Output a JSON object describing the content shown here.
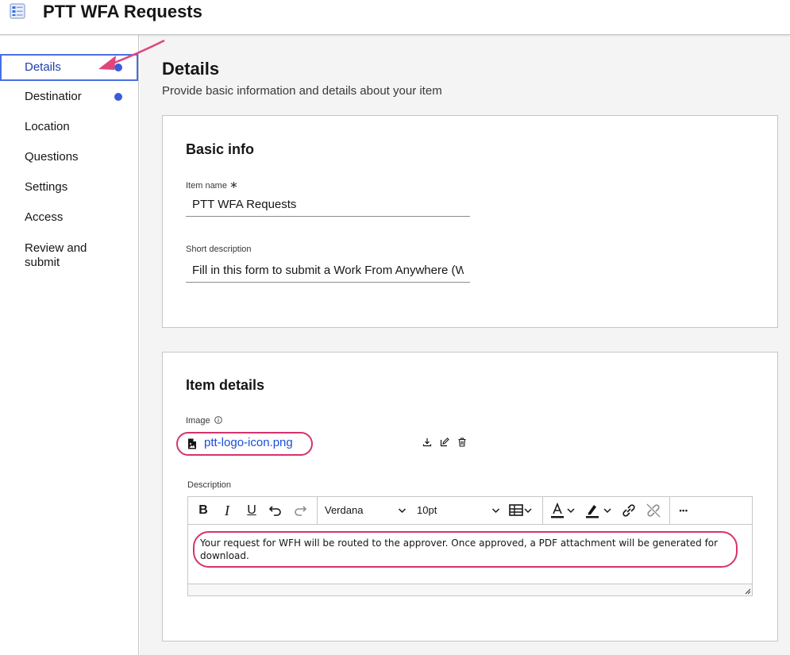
{
  "header": {
    "title": "PTT WFA Requests",
    "icon": "form-list-icon"
  },
  "sidebar": {
    "items": [
      {
        "label": "Details",
        "active": true,
        "dot": true
      },
      {
        "label": "Destinatior",
        "active": false,
        "dot": true
      },
      {
        "label": "Location",
        "active": false,
        "dot": false
      },
      {
        "label": "Questions",
        "active": false,
        "dot": false
      },
      {
        "label": "Settings",
        "active": false,
        "dot": false
      },
      {
        "label": "Access",
        "active": false,
        "dot": false
      },
      {
        "label": "Review and submit",
        "active": false,
        "dot": false
      }
    ],
    "dot_color": "#3b5bdb"
  },
  "main": {
    "title": "Details",
    "subtitle": "Provide basic information and details about your item",
    "basic_info": {
      "title": "Basic info",
      "item_name_label": "Item name",
      "required_mark": "∗",
      "item_name_value": "PTT WFA Requests",
      "short_description_label": "Short description",
      "short_description_value": "Fill in this form to submit a Work From Anywhere (W"
    },
    "item_details": {
      "title": "Item details",
      "image_label": "Image",
      "image_info_icon": "info-icon",
      "image_file": "ptt-logo-icon.png",
      "image_actions": [
        "download-icon",
        "edit-icon",
        "delete-icon"
      ],
      "description_label": "Description",
      "editor": {
        "font_family": "Verdana",
        "font_size": "10pt",
        "tools": [
          "bold-icon",
          "italic-icon",
          "underline-icon",
          "undo-icon",
          "redo-icon",
          "table-icon",
          "text-color-icon",
          "highlight-icon",
          "link-icon",
          "unlink-icon",
          "more-icon"
        ],
        "bold_glyph": "B",
        "italic_glyph": "I",
        "underline_glyph": "U",
        "more_glyph": "•••",
        "content": "Your request for WFH will be routed to the approver.  Once approved, a PDF attachment will be generated for download."
      }
    }
  },
  "colors": {
    "accent": "#4a6fe3",
    "annotation": "#d6336c",
    "link": "#1d4fd8"
  }
}
